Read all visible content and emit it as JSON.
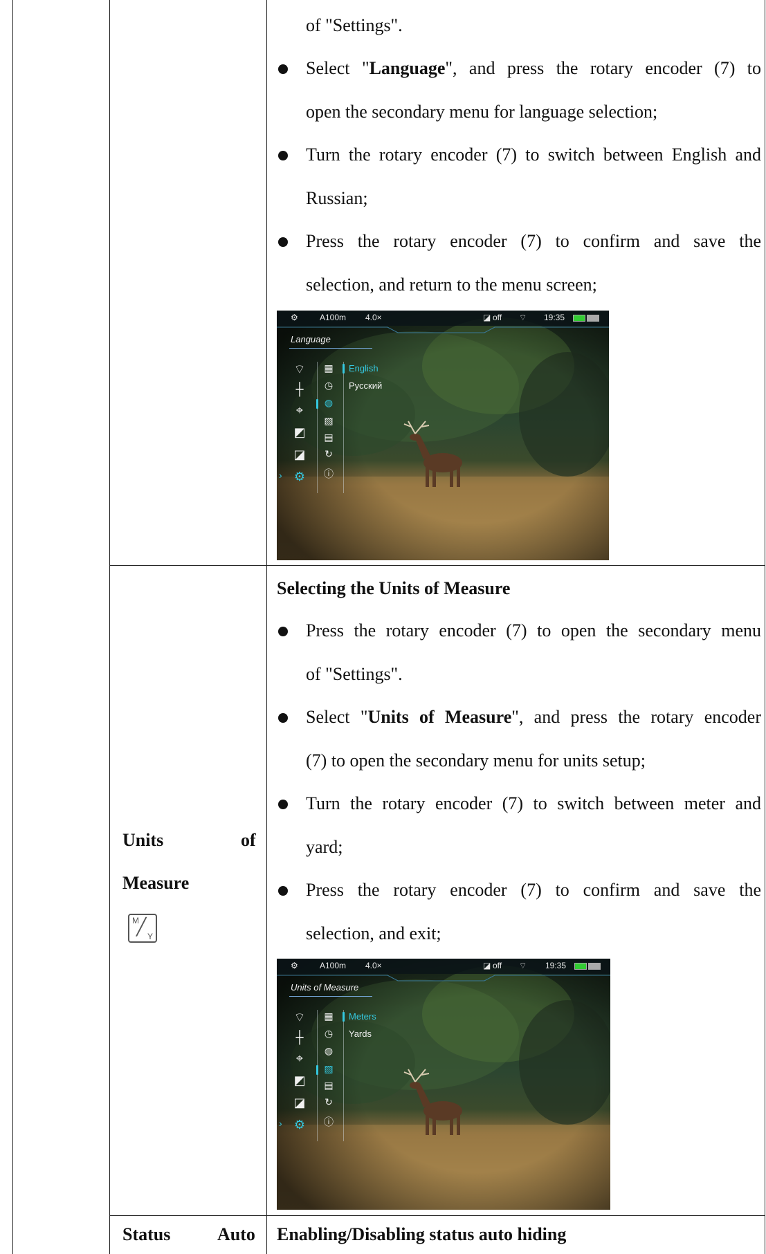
{
  "section_language": {
    "cont_line": "of \"Settings\".",
    "b1_pre": "Select \"",
    "b1_bold": "Language",
    "b1_post": "\", and press the rotary encoder (7) to",
    "b1_line2": "open the secondary menu for language selection;",
    "b2_line1": "Turn the rotary encoder (7) to switch between English and",
    "b2_line2": "Russian;",
    "b3_line1": "Press the rotary encoder (7) to confirm and save the",
    "b3_line2": "selection, and return to the menu screen;",
    "screen": {
      "status": {
        "range": "A100m",
        "zoom": "4.0×",
        "pip": "off",
        "time": "19:35"
      },
      "menu_title": "Language",
      "options": [
        "English",
        "Русский"
      ],
      "selected_option": "English"
    }
  },
  "section_units": {
    "label_line1_a": "Units",
    "label_line1_b": "of",
    "label_line2": "Measure",
    "icon_text_top": "M",
    "icon_text_bottom": "Y",
    "heading": "Selecting the Units of Measure",
    "b1_line1": "Press the rotary encoder (7) to open the secondary menu",
    "b1_line2": "of \"Settings\".",
    "b2_pre": "Select \"",
    "b2_bold": "Units of Measure",
    "b2_post": "\", and press the rotary encoder",
    "b2_line2": "(7) to open the secondary menu for units setup;",
    "b3_line1": "Turn the rotary encoder (7) to switch between meter and",
    "b3_line2": "yard;",
    "b4_line1": "Press the rotary encoder (7) to confirm and save the",
    "b4_line2": "selection, and exit;",
    "screen": {
      "status": {
        "range": "A100m",
        "zoom": "4.0×",
        "pip": "off",
        "time": "19:35"
      },
      "menu_title": "Units of Measure",
      "options": [
        "Meters",
        "Yards"
      ],
      "selected_option": "Meters"
    }
  },
  "section_status": {
    "label_a": "Status",
    "label_b": "Auto",
    "heading": "Enabling/Disabling status auto hiding"
  },
  "colors": {
    "accent": "#34c8e0"
  }
}
